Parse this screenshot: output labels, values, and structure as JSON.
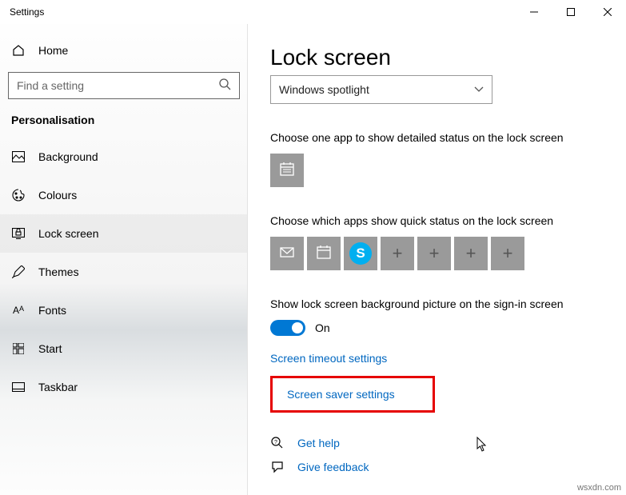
{
  "window": {
    "title": "Settings"
  },
  "sidebar": {
    "home": "Home",
    "search_placeholder": "Find a setting",
    "category": "Personalisation",
    "items": [
      {
        "label": "Background",
        "icon": "image-icon"
      },
      {
        "label": "Colours",
        "icon": "palette-icon"
      },
      {
        "label": "Lock screen",
        "icon": "lockscreen-icon"
      },
      {
        "label": "Themes",
        "icon": "pencil-icon"
      },
      {
        "label": "Fonts",
        "icon": "font-icon"
      },
      {
        "label": "Start",
        "icon": "startgrid-icon"
      },
      {
        "label": "Taskbar",
        "icon": "taskbar-icon"
      }
    ]
  },
  "main": {
    "title": "Lock screen",
    "dropdown_value": "Windows spotlight",
    "detailed_label": "Choose one app to show detailed status on the lock screen",
    "quick_label": "Choose which apps show quick status on the lock screen",
    "signin_label": "Show lock screen background picture on the sign-in screen",
    "toggle_state": "On",
    "link_timeout": "Screen timeout settings",
    "link_saver": "Screen saver settings",
    "help": "Get help",
    "feedback": "Give feedback"
  },
  "watermark": "wsxdn.com"
}
